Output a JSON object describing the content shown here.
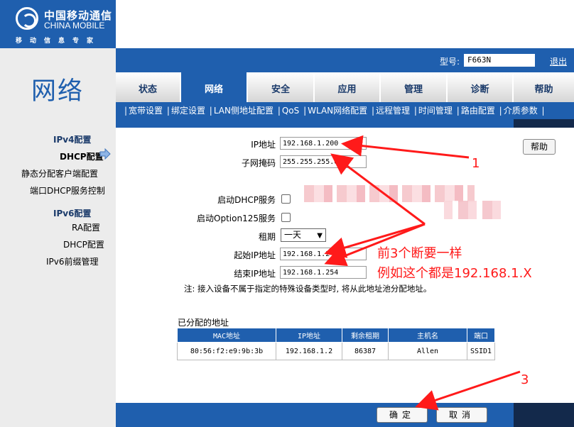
{
  "brand": {
    "cn": "中国移动通信",
    "en": "CHINA MOBILE",
    "tagline": "移动信息专家"
  },
  "header": {
    "model_label": "型号:",
    "model_value": "F663N",
    "logout": "退出"
  },
  "page_title": "网络",
  "tabs": [
    {
      "label": "状态",
      "active": false
    },
    {
      "label": "网络",
      "active": true
    },
    {
      "label": "安全",
      "active": false
    },
    {
      "label": "应用",
      "active": false
    },
    {
      "label": "管理",
      "active": false
    },
    {
      "label": "诊断",
      "active": false
    },
    {
      "label": "帮助",
      "active": false
    }
  ],
  "subnav": [
    "宽带设置",
    "绑定设置",
    "LAN侧地址配置",
    "QoS",
    "WLAN网络配置",
    "远程管理",
    "时间管理",
    "路由配置",
    "介质参数"
  ],
  "leftnav": {
    "ipv4_head": "IPv4配置",
    "ipv4_items": [
      "DHCP配置",
      "静态分配客户端配置",
      "端口DHCP服务控制"
    ],
    "ipv6_head": "IPv6配置",
    "ipv6_items": [
      "RA配置",
      "DHCP配置",
      "IPv6前缀管理"
    ]
  },
  "form": {
    "ip_label": "IP地址",
    "ip_value": "192.168.1.200",
    "mask_label": "子网掩码",
    "mask_value": "255.255.255.0",
    "dhcp_label": "启动DHCP服务",
    "dhcp_checked": false,
    "opt125_label": "启动Option125服务",
    "opt125_checked": false,
    "lease_label": "租期",
    "lease_value": "一天",
    "start_label": "起始IP地址",
    "start_value": "192.168.1.2",
    "end_label": "结束IP地址",
    "end_value": "192.168.1.254",
    "note": "注: 接入设备不属于指定的特殊设备类型时, 将从此地址池分配地址。"
  },
  "assigned": {
    "title": "已分配的地址",
    "columns": [
      "MAC地址",
      "IP地址",
      "剩余租期",
      "主机名",
      "端口"
    ],
    "rows": [
      [
        "80:56:f2:e9:9b:3b",
        "192.168.1.2",
        "86387",
        "Allen",
        "SSID1"
      ]
    ]
  },
  "buttons": {
    "help": "帮助",
    "ok": "确定",
    "cancel": "取消"
  },
  "annotations": {
    "num1": "1",
    "text_line1": "前3个断要一样",
    "text_line2": "例如这个都是192.168.1.X",
    "num3": "3",
    "color": "#ff1a1a"
  }
}
